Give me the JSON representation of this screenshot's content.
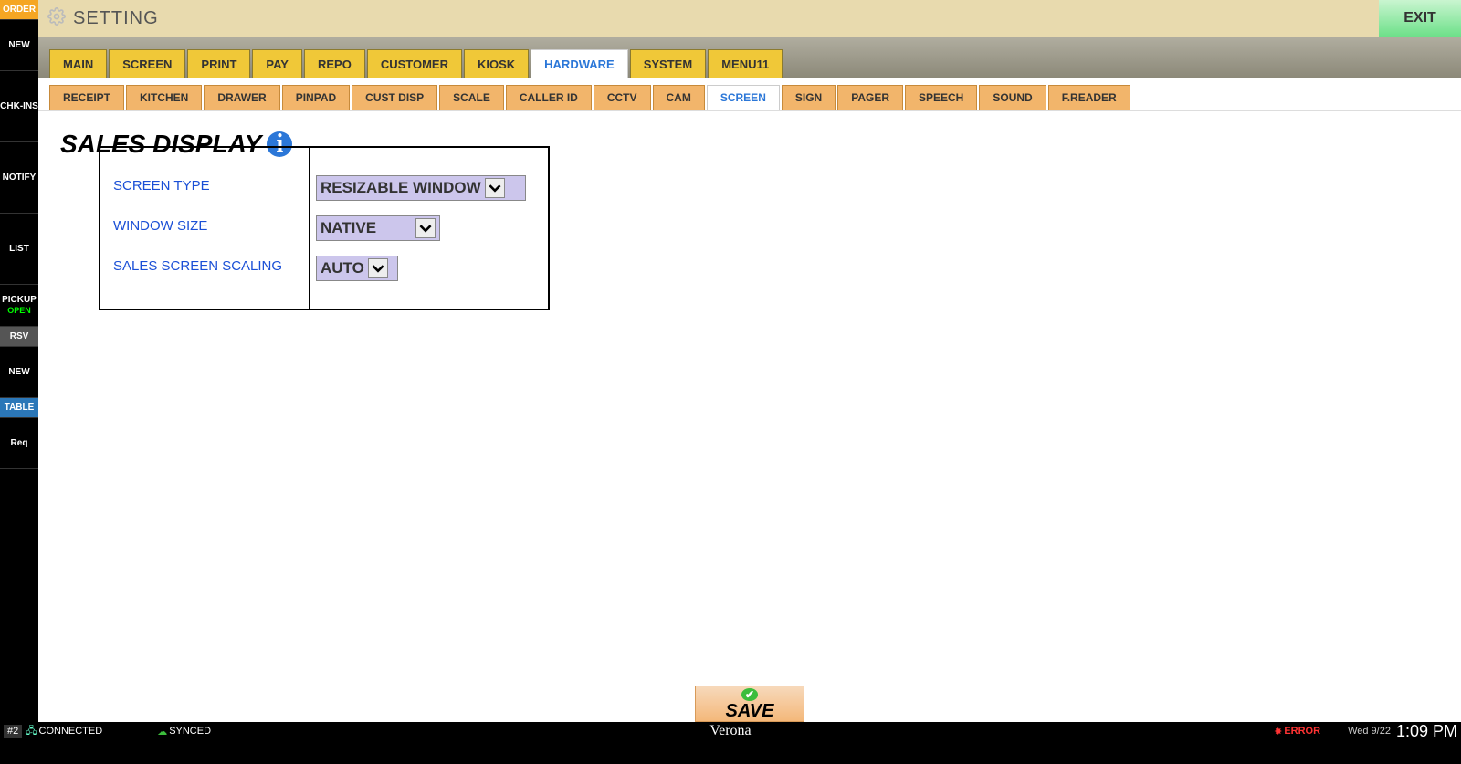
{
  "sidebar": {
    "order": "ORDER",
    "new1": "NEW",
    "chkins": "CHK-INS",
    "notify": "NOTIFY",
    "list": "LIST",
    "pickup": "PICKUP",
    "pickup_sub": "OPEN",
    "rsv": "RSV",
    "new2": "NEW",
    "table": "TABLE",
    "req": "Req"
  },
  "header": {
    "title": "SETTING",
    "exit": "EXIT"
  },
  "tabs1": [
    "MAIN",
    "SCREEN",
    "PRINT",
    "PAY",
    "REPO",
    "CUSTOMER",
    "KIOSK",
    "HARDWARE",
    "SYSTEM",
    "MENU11"
  ],
  "tabs1_active": 7,
  "tabs2": [
    "RECEIPT",
    "KITCHEN",
    "DRAWER",
    "PINPAD",
    "CUST DISP",
    "SCALE",
    "CALLER ID",
    "CCTV",
    "CAM",
    "SCREEN",
    "SIGN",
    "PAGER",
    "SPEECH",
    "SOUND",
    "F.READER"
  ],
  "tabs2_active": 9,
  "section": {
    "title": "SALES DISPLAY",
    "labels": [
      "SCREEN TYPE",
      "WINDOW SIZE",
      "SALES SCREEN SCALING"
    ],
    "values": [
      "RESIZABLE WINDOW",
      "NATIVE",
      "AUTO"
    ]
  },
  "save": "SAVE",
  "status": {
    "num": "#2",
    "connected": "CONNECTED",
    "synced": "SYNCED",
    "brand": "Verona",
    "error": "ERROR",
    "date": "Wed 9/22",
    "time": "1:09 PM"
  }
}
